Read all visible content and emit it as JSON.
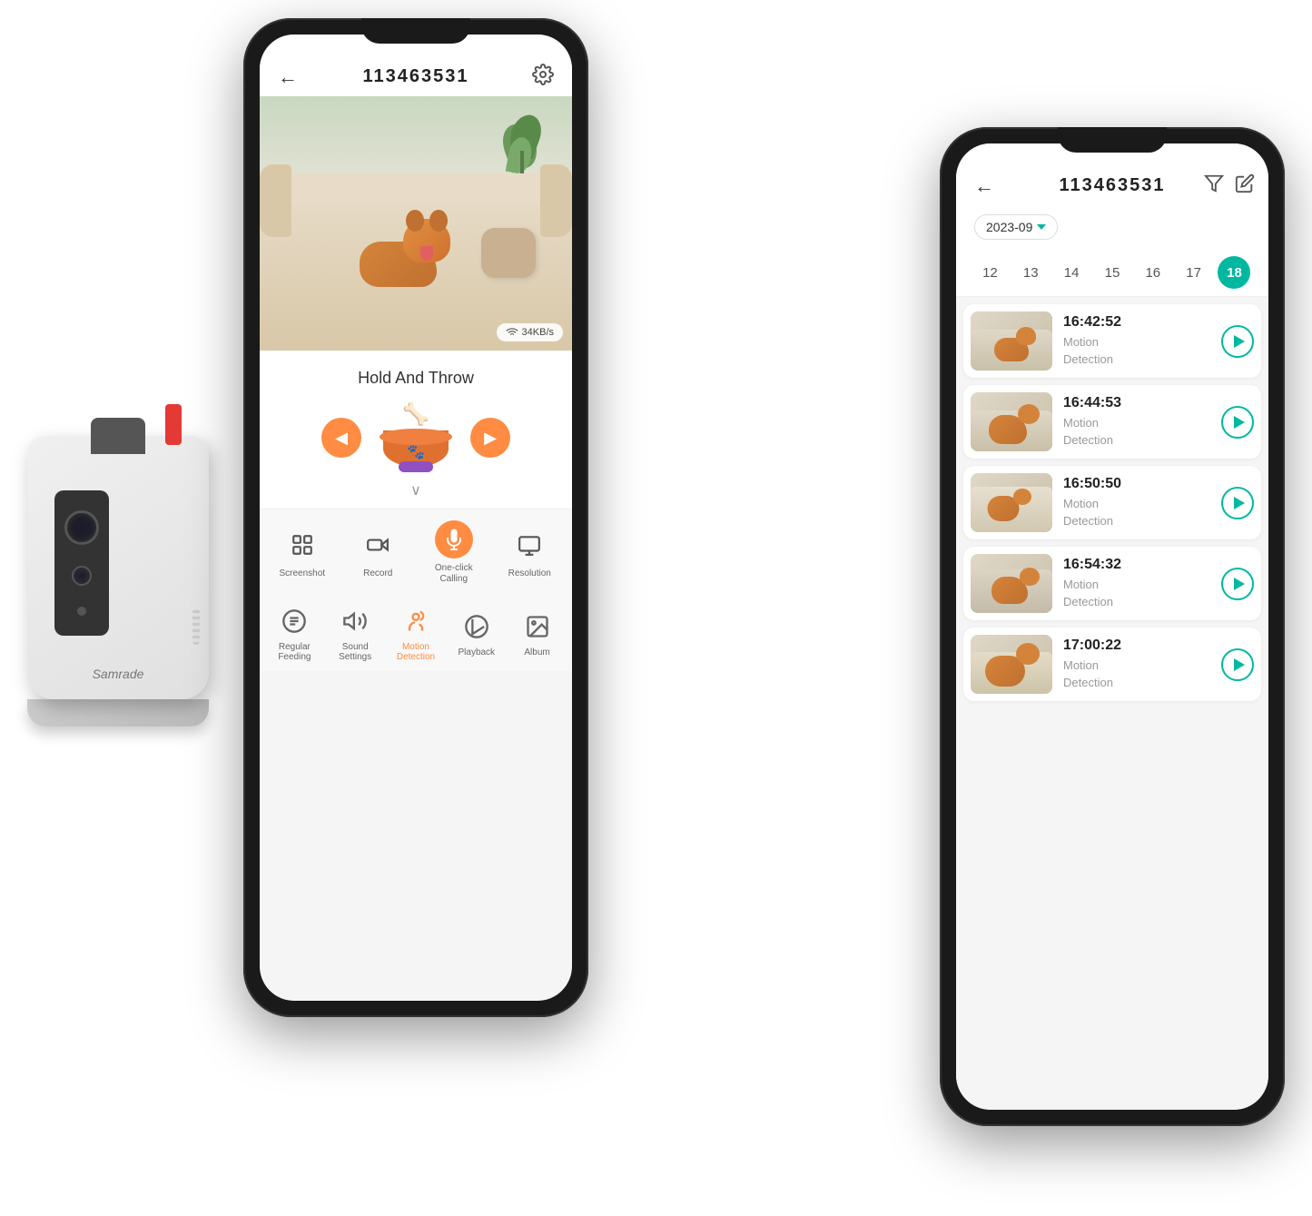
{
  "camera": {
    "brand": "Samrade"
  },
  "phone1": {
    "header": {
      "title": "113463531",
      "back_arrow": "←"
    },
    "video": {
      "speed": "34KB/s"
    },
    "throw_section": {
      "title": "Hold And Throw",
      "left_btn": "◀",
      "right_btn": "▶",
      "chevron": "∨"
    },
    "toolbar": [
      {
        "id": "screenshot",
        "label": "Screenshot",
        "icon": "⊞"
      },
      {
        "id": "record",
        "label": "Record",
        "icon": "▣"
      },
      {
        "id": "calling",
        "label": "One-click\nCalling",
        "icon": "🎤",
        "active": true
      },
      {
        "id": "resolution",
        "label": "Resolution",
        "icon": "🖥"
      }
    ],
    "bottombar": [
      {
        "id": "feeding",
        "label": "Regular\nFeeding",
        "icon": "🥣"
      },
      {
        "id": "sound",
        "label": "Sound\nSettings",
        "icon": "🔊"
      },
      {
        "id": "motion",
        "label": "Motion\nDetection",
        "icon": "🐾",
        "active": true
      },
      {
        "id": "playback",
        "label": "Playback",
        "icon": "▶"
      },
      {
        "id": "album",
        "label": "Album",
        "icon": "🖼"
      }
    ]
  },
  "phone2": {
    "header": {
      "title": "113463531",
      "back_arrow": "←"
    },
    "date": {
      "month": "2023-09",
      "arrow": "▼"
    },
    "calendar": {
      "days": [
        {
          "num": "12",
          "active": false
        },
        {
          "num": "13",
          "active": false
        },
        {
          "num": "14",
          "active": false
        },
        {
          "num": "15",
          "active": false
        },
        {
          "num": "16",
          "active": false
        },
        {
          "num": "17",
          "active": false
        },
        {
          "num": "18",
          "active": true
        }
      ]
    },
    "recordings": [
      {
        "time": "16:42:52",
        "type": "Motion\nDetection"
      },
      {
        "time": "16:44:53",
        "type": "Motion\nDetection"
      },
      {
        "time": "16:50:50",
        "type": "Motion\nDetection"
      },
      {
        "time": "16:54:32",
        "type": "Motion\nDetection"
      },
      {
        "time": "17:00:22",
        "type": "Motion\nDetection"
      }
    ]
  }
}
